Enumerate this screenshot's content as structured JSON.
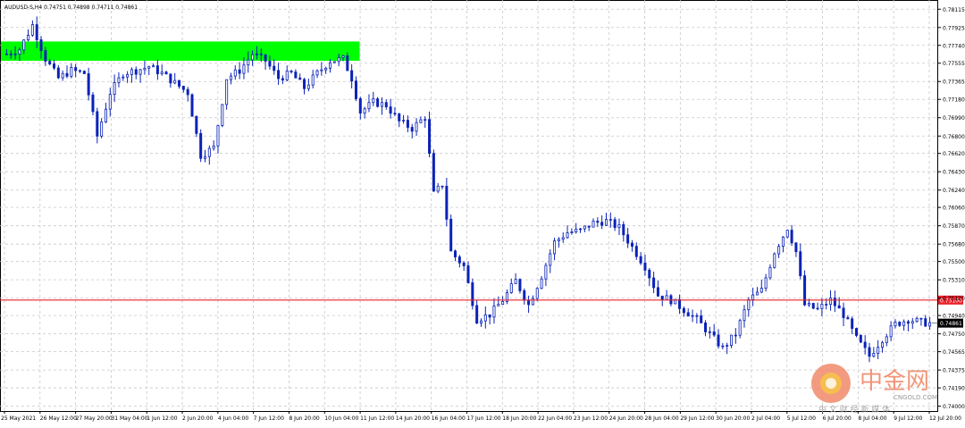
{
  "header": {
    "symbol_label": "AUDUSD-S,H4",
    "ohlc_text": "0.74751 0.74898 0.74711 0.74861"
  },
  "price_axis": {
    "labels": [
      "0.78115",
      "0.77925",
      "0.77740",
      "0.77555",
      "0.77365",
      "0.77180",
      "0.76990",
      "0.76800",
      "0.76620",
      "0.76430",
      "0.76240",
      "0.76060",
      "0.75870",
      "0.75680",
      "0.75500",
      "0.75310",
      "0.75120",
      "0.74940",
      "0.74750",
      "0.74565",
      "0.74375",
      "0.74190",
      "0.74000"
    ]
  },
  "time_axis": {
    "labels": [
      "25 May 2021",
      "26 May 12:00",
      "27 May 20:00",
      "31 May 04:00",
      "1 Jun 12:00",
      "2 Jun 20:00",
      "4 Jun 04:00",
      "7 Jun 12:00",
      "8 Jun 20:00",
      "10 Jun 04:00",
      "11 Jun 12:00",
      "14 Jun 20:00",
      "16 Jun 04:00",
      "17 Jun 12:00",
      "18 Jun 20:00",
      "22 Jun 04:00",
      "23 Jun 12:00",
      "24 Jun 20:00",
      "28 Jun 04:00",
      "29 Jun 12:00",
      "30 Jun 20:00",
      "2 Jul 04:00",
      "5 Jul 12:00",
      "6 Jul 20:00",
      "8 Jul 04:00",
      "9 Jul 12:00",
      "12 Jul 20:00"
    ]
  },
  "level_line": {
    "price": 0.751,
    "label": "0.75100",
    "color": "#e8202a"
  },
  "current_price": {
    "price": 0.74861,
    "label": "0.74861"
  },
  "resistance_zone": {
    "price_low": 0.7758,
    "price_high": 0.7778,
    "from_index": 0,
    "to_index": 81,
    "color": "#00ff00"
  },
  "watermark": {
    "brand": "中金网",
    "site": "CNGOLD.COM",
    "tagline": "中 文 财 经 新 媒 体"
  },
  "colors": {
    "bull": "#0a22b8",
    "bear": "#0a22b8",
    "grid": "#c8c8c8",
    "axis": "#000000"
  },
  "chart_data": {
    "type": "candlestick",
    "timeframe": "H4",
    "symbol": "AUDUSD-S",
    "ylim": [
      0.7395,
      0.7821
    ],
    "grid": true,
    "anchors": [
      [
        0,
        0.7765
      ],
      [
        3,
        0.777
      ],
      [
        6,
        0.7795
      ],
      [
        9,
        0.776
      ],
      [
        12,
        0.774
      ],
      [
        15,
        0.7748
      ],
      [
        18,
        0.7745
      ],
      [
        21,
        0.768
      ],
      [
        24,
        0.7725
      ],
      [
        27,
        0.7745
      ],
      [
        30,
        0.7748
      ],
      [
        33,
        0.7752
      ],
      [
        36,
        0.7745
      ],
      [
        39,
        0.7735
      ],
      [
        42,
        0.7725
      ],
      [
        45,
        0.766
      ],
      [
        48,
        0.7668
      ],
      [
        51,
        0.774
      ],
      [
        54,
        0.7748
      ],
      [
        57,
        0.7765
      ],
      [
        60,
        0.7758
      ],
      [
        63,
        0.774
      ],
      [
        66,
        0.7745
      ],
      [
        69,
        0.773
      ],
      [
        72,
        0.7745
      ],
      [
        75,
        0.7758
      ],
      [
        78,
        0.776
      ],
      [
        80,
        0.774
      ],
      [
        82,
        0.7705
      ],
      [
        85,
        0.7715
      ],
      [
        88,
        0.7712
      ],
      [
        91,
        0.7695
      ],
      [
        94,
        0.7688
      ],
      [
        97,
        0.77
      ],
      [
        99,
        0.762
      ],
      [
        101,
        0.763
      ],
      [
        103,
        0.756
      ],
      [
        106,
        0.7545
      ],
      [
        109,
        0.749
      ],
      [
        112,
        0.7495
      ],
      [
        115,
        0.751
      ],
      [
        118,
        0.753
      ],
      [
        121,
        0.7505
      ],
      [
        124,
        0.7535
      ],
      [
        127,
        0.757
      ],
      [
        130,
        0.758
      ],
      [
        133,
        0.7582
      ],
      [
        136,
        0.759
      ],
      [
        139,
        0.7592
      ],
      [
        142,
        0.7585
      ],
      [
        145,
        0.7565
      ],
      [
        148,
        0.7545
      ],
      [
        151,
        0.7515
      ],
      [
        154,
        0.751
      ],
      [
        157,
        0.75
      ],
      [
        160,
        0.749
      ],
      [
        163,
        0.7475
      ],
      [
        166,
        0.746
      ],
      [
        169,
        0.7475
      ],
      [
        172,
        0.751
      ],
      [
        175,
        0.752
      ],
      [
        178,
        0.756
      ],
      [
        181,
        0.7585
      ],
      [
        183,
        0.756
      ],
      [
        185,
        0.7505
      ],
      [
        188,
        0.75
      ],
      [
        191,
        0.751
      ],
      [
        194,
        0.7495
      ],
      [
        197,
        0.747
      ],
      [
        200,
        0.7452
      ],
      [
        203,
        0.747
      ],
      [
        206,
        0.7485
      ],
      [
        209,
        0.749
      ],
      [
        212,
        0.7487
      ],
      [
        214,
        0.7486
      ]
    ],
    "n_bars": 215
  }
}
